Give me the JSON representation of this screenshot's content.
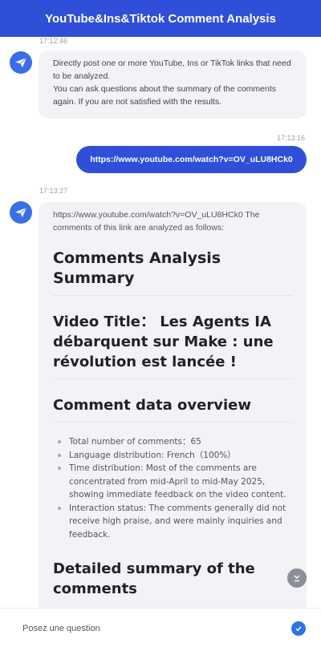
{
  "header": {
    "title": "YouTube&Ins&Tiktok Comment Analysis"
  },
  "messages": {
    "m0": {
      "time": "17:12:46",
      "lines": [
        "Directly post one or more YouTube, Ins or TikTok links that need to be analyzed.",
        "You can ask questions about the summary of the comments again. If you are not satisfied with the results."
      ]
    },
    "m1": {
      "time": "17:13:16",
      "text": "https://www.youtube.com/watch?v=OV_uLU8HCk0"
    },
    "m2": {
      "time": "17:13:27",
      "intro": "https://www.youtube.com/watch?v=OV_uLU8HCk0 The comments of this link are analyzed as follows:",
      "heading1": "Comments Analysis Summary",
      "heading2": "Video Title： Les Agents IA débarquent sur Make : une révolution est lancée !",
      "heading3": "Comment data overview",
      "bullets": [
        "Total number of comments：65",
        "Language distribution: French（100%）",
        "Time distribution: Most of the comments are concentrated from mid-April to mid-May 2025, showing immediate feedback on the video content.",
        "Interaction status: The comments generally did not receive high praise, and were mainly inquiries and feedback."
      ],
      "heading4": "Detailed summary of the comments"
    }
  },
  "input": {
    "placeholder": "Posez une question"
  },
  "icons": {
    "bot_avatar": "paper-plane-icon",
    "scroll_down": "chevron-double-down-icon",
    "send": "check-circle-icon"
  },
  "colors": {
    "accent": "#2f4fd8",
    "bubble_bg": "#f2f3f6",
    "send": "#2a73e8"
  }
}
